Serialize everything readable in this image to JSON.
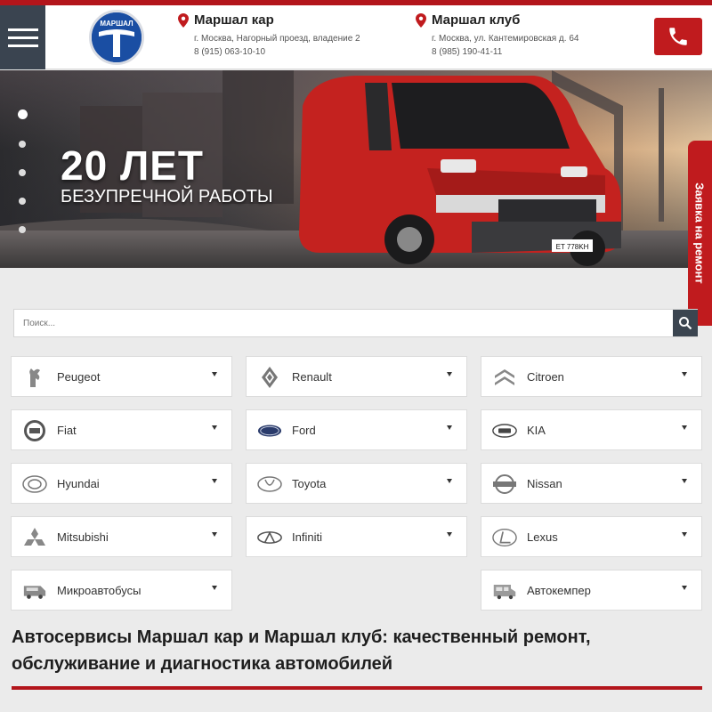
{
  "header": {
    "logo_text": "МАРШАЛ",
    "locations": [
      {
        "name": "Маршал кар",
        "address": "г. Москва, Нагорный проезд, владение 2",
        "phone": "8 (915) 063-10-10"
      },
      {
        "name": "Маршал клуб",
        "address": "г. Москва, ул. Кантемировская д. 64",
        "phone": "8 (985) 190-41-11"
      }
    ],
    "menu_icon": "hamburger-icon",
    "call_icon": "phone-icon"
  },
  "hero": {
    "title": "20 ЛЕТ",
    "subtitle": "БЕЗУПРЕЧНОЙ РАБОТЫ",
    "slides_count": 5,
    "active_slide": 1,
    "plate": "ET 778KH"
  },
  "side_tab": {
    "label": "Заявка на ремонт"
  },
  "search": {
    "placeholder": "Поиск...",
    "icon": "search-icon"
  },
  "brands": [
    {
      "label": "Peugeot",
      "icon": "peugeot-logo-icon"
    },
    {
      "label": "Renault",
      "icon": "renault-logo-icon"
    },
    {
      "label": "Citroen",
      "icon": "citroen-logo-icon"
    },
    {
      "label": "Fiat",
      "icon": "fiat-logo-icon"
    },
    {
      "label": "Ford",
      "icon": "ford-logo-icon"
    },
    {
      "label": "KIA",
      "icon": "kia-logo-icon"
    },
    {
      "label": "Hyundai",
      "icon": "hyundai-logo-icon"
    },
    {
      "label": "Toyota",
      "icon": "toyota-logo-icon"
    },
    {
      "label": "Nissan",
      "icon": "nissan-logo-icon"
    },
    {
      "label": "Mitsubishi",
      "icon": "mitsubishi-logo-icon"
    },
    {
      "label": "Infiniti",
      "icon": "infiniti-logo-icon"
    },
    {
      "label": "Lexus",
      "icon": "lexus-logo-icon"
    },
    {
      "label": "Микроавтобусы",
      "icon": "minibus-icon"
    },
    {
      "label": "Автокемпер",
      "icon": "camper-icon"
    }
  ],
  "main": {
    "title": "Автосервисы Маршал кар и Маршал клуб: качественный ремонт, обслуживание и диагностика автомобилей"
  },
  "colors": {
    "brand_red": "#c01b1e",
    "dark_panel": "#3a4450"
  }
}
